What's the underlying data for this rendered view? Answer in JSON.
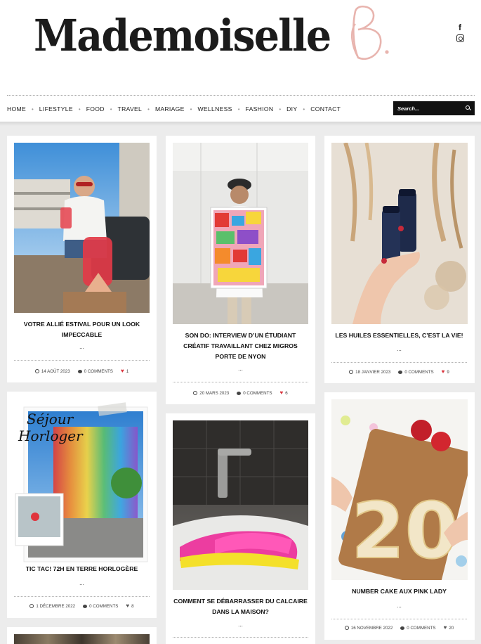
{
  "site": {
    "logo_text": "Mademoiselle",
    "logo_mark": "B."
  },
  "social": {
    "facebook_icon": "f",
    "instagram_icon": "instagram"
  },
  "nav": {
    "items": [
      "HOME",
      "LIFESTYLE",
      "FOOD",
      "TRAVEL",
      "MARIAGE",
      "WELLNESS",
      "FASHION",
      "DIY",
      "CONTACT"
    ],
    "separator": "•"
  },
  "search": {
    "placeholder": "Search..."
  },
  "posts": [
    {
      "title": "VOTRE ALLIÉ ESTIVAL POUR UN LOOK IMPECCABLE",
      "excerpt": "...",
      "date": "14 AOÛT 2023",
      "comments": "0 COMMENTS",
      "likes": "1"
    },
    {
      "title": "SON DO: INTERVIEW D’UN ÉTUDIANT CRÉATIF TRAVAILLANT CHEZ MIGROS PORTE DE NYON",
      "excerpt": "...",
      "date": "20 MARS 2023",
      "comments": "0 COMMENTS",
      "likes": "6"
    },
    {
      "title": "LES HUILES ESSENTIELLES, C’EST LA VIE!",
      "excerpt": "...",
      "date": "18 JANVIER 2023",
      "comments": "0 COMMENTS",
      "likes": "9"
    },
    {
      "title": "TIC TAC! 72H EN TERRE HORLOGÈRE",
      "excerpt": "...",
      "date": "1 DÉCEMBRE 2022",
      "comments": "0 COMMENTS",
      "likes": "8"
    },
    {
      "title": "COMMENT SE DÉBARRASSER DU CALCAIRE DANS LA MAISON?",
      "excerpt": "..."
    },
    {
      "title": "NUMBER CAKE AUX PINK LADY",
      "excerpt": "...",
      "date": "16 NOVEMBRE 2022",
      "comments": "0 COMMENTS",
      "likes": "20"
    }
  ],
  "image_text": {
    "sejour": "Séjour",
    "horloger": "Horloger",
    "cake_number": "20"
  },
  "colors": {
    "accent_heart": "#d9323b",
    "logo_mark": "#e8b4ae",
    "nav_bg": "#111111"
  }
}
